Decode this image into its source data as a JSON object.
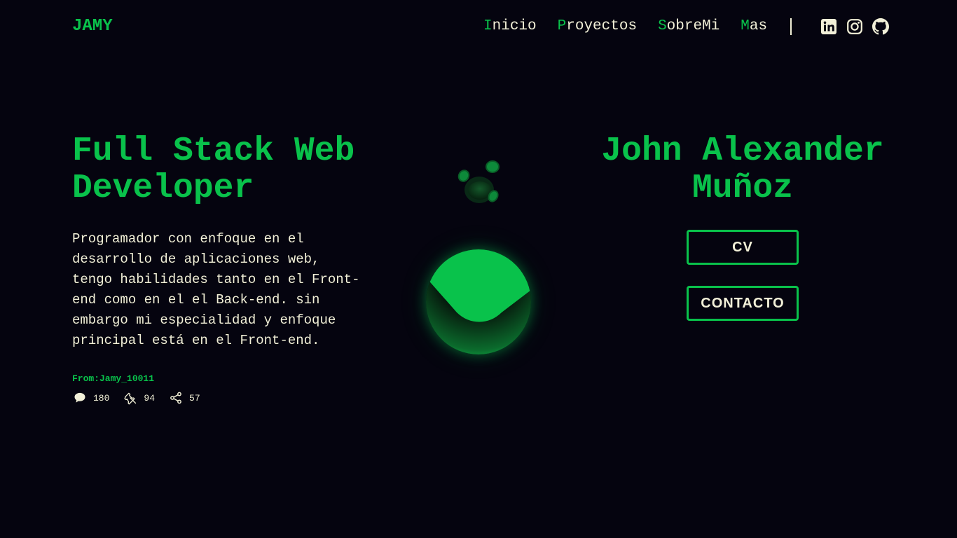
{
  "header": {
    "logo": "JAMY",
    "nav": [
      {
        "initial": "I",
        "rest": "nicio"
      },
      {
        "initial": "P",
        "rest": "royectos"
      },
      {
        "initial": "S",
        "rest": "obreMi"
      },
      {
        "initial": "M",
        "rest": "as"
      }
    ],
    "social_icons": [
      "linkedin-icon",
      "instagram-icon",
      "github-icon"
    ]
  },
  "hero": {
    "title": "Full Stack Web Developer",
    "description": "Programador con enfoque en el desarrollo de aplicaciones web, tengo habilidades tanto en el Front-end como en el el Back-end. sin embargo mi especialidad y enfoque principal está en el Front-end.",
    "from": "From:Jamy_10011",
    "stats": {
      "comments": "180",
      "pins": "94",
      "shares": "57"
    }
  },
  "profile": {
    "name": "John Alexander Muñoz",
    "cv_button": "CV",
    "contact_button": "CONTACTO"
  },
  "colors": {
    "accent": "#09c24b",
    "background": "#05040f",
    "text": "#f2f0d8"
  }
}
